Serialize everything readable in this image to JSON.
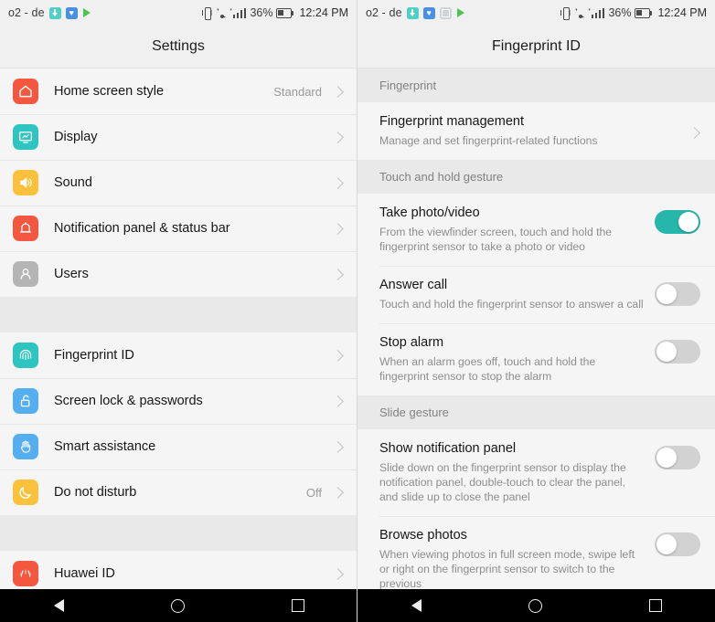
{
  "statusbar": {
    "carrier": "o2 - de",
    "battery_percent": "36%",
    "time": "12:24 PM",
    "icons_left_settings": [
      "download-icon",
      "health-icon",
      "play-store-icon"
    ],
    "icons_left_fingerprint": [
      "download-icon",
      "health-icon",
      "screenshot-icon",
      "play-store-icon"
    ],
    "icons_right": [
      "vibrate-icon",
      "wifi-icon",
      "signal-icon",
      "battery-icon"
    ]
  },
  "navbar": {
    "back": "back-button",
    "home": "home-button",
    "recents": "recents-button"
  },
  "colors": {
    "accent_teal": "#26b6ab",
    "toggle_off": "#d2d2d2",
    "list_bg": "#f5f5f5",
    "section_bg": "#e9e9e9",
    "icon_red": "#f4573f",
    "icon_teal": "#2ec4c0",
    "icon_yellow": "#f9c13c",
    "icon_gray": "#b5b5b5",
    "icon_blue": "#55aef0"
  },
  "settings": {
    "title": "Settings",
    "groups": [
      {
        "items": [
          {
            "label": "Home screen style",
            "value": "Standard",
            "icon": "home-icon",
            "icon_color": "#f4573f"
          },
          {
            "label": "Display",
            "value": "",
            "icon": "display-icon",
            "icon_color": "#2ec4c0"
          },
          {
            "label": "Sound",
            "value": "",
            "icon": "sound-icon",
            "icon_color": "#f9c13c"
          },
          {
            "label": "Notification panel & status bar",
            "value": "",
            "icon": "bell-icon",
            "icon_color": "#f4573f"
          },
          {
            "label": "Users",
            "value": "",
            "icon": "user-icon",
            "icon_color": "#b5b5b5"
          }
        ]
      },
      {
        "items": [
          {
            "label": "Fingerprint ID",
            "value": "",
            "icon": "fingerprint-icon",
            "icon_color": "#2ec4c0"
          },
          {
            "label": "Screen lock & passwords",
            "value": "",
            "icon": "unlock-icon",
            "icon_color": "#55aef0"
          },
          {
            "label": "Smart assistance",
            "value": "",
            "icon": "hand-icon",
            "icon_color": "#55aef0"
          },
          {
            "label": "Do not disturb",
            "value": "Off",
            "icon": "moon-icon",
            "icon_color": "#f9c13c"
          }
        ]
      },
      {
        "items": [
          {
            "label": "Huawei ID",
            "value": "",
            "icon": "huawei-logo-icon",
            "icon_color": "#f4573f"
          }
        ]
      }
    ]
  },
  "fingerprint": {
    "title": "Fingerprint ID",
    "sections": [
      {
        "header": "Fingerprint",
        "rows": [
          {
            "title": "Fingerprint management",
            "subtitle": "Manage and set fingerprint-related functions",
            "control": "chevron"
          }
        ]
      },
      {
        "header": "Touch and hold gesture",
        "rows": [
          {
            "title": "Take photo/video",
            "subtitle": "From the viewfinder screen, touch and hold the fingerprint sensor to take a photo or video",
            "control": "toggle",
            "state": "on"
          },
          {
            "title": "Answer call",
            "subtitle": "Touch and hold the fingerprint sensor to answer a call",
            "control": "toggle",
            "state": "off"
          },
          {
            "title": "Stop alarm",
            "subtitle": "When an alarm goes off, touch and hold the fingerprint sensor to stop the alarm",
            "control": "toggle",
            "state": "off"
          }
        ]
      },
      {
        "header": "Slide gesture",
        "rows": [
          {
            "title": "Show notification panel",
            "subtitle": "Slide down on the fingerprint sensor to display the notification panel, double-touch to clear the panel, and slide up to close the panel",
            "control": "toggle",
            "state": "off"
          },
          {
            "title": "Browse photos",
            "subtitle": "When viewing photos in full screen mode, swipe left or right on the fingerprint sensor to switch to the previous",
            "control": "toggle",
            "state": "off"
          }
        ]
      }
    ]
  }
}
